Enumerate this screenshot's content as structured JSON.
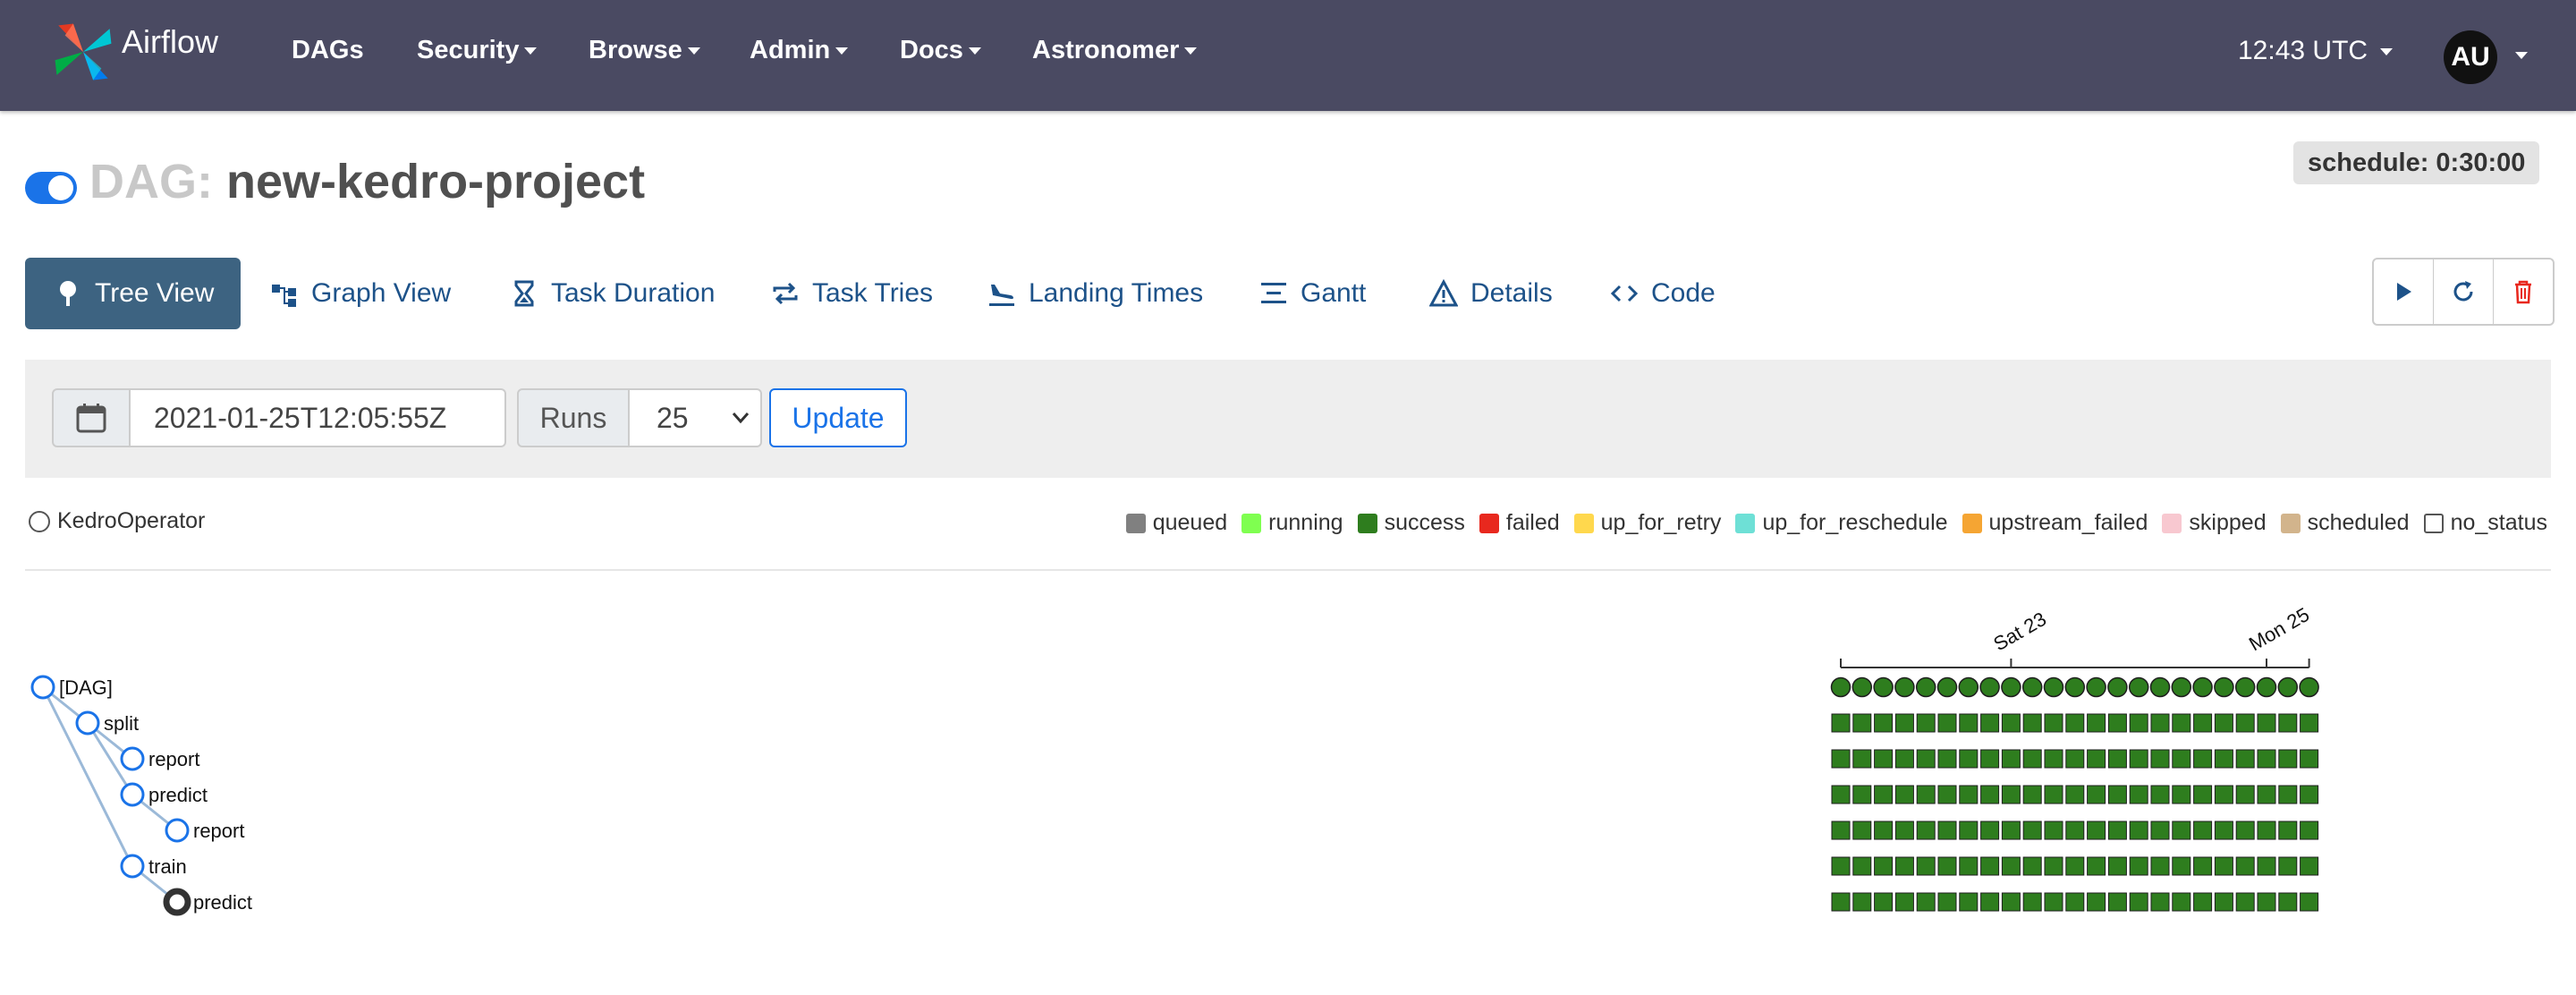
{
  "nav": {
    "brand": "Airflow",
    "items": [
      "DAGs",
      "Security",
      "Browse",
      "Admin",
      "Docs",
      "Astronomer"
    ],
    "time": "12:43 UTC",
    "avatar": "AU"
  },
  "dag": {
    "prefix": "DAG:",
    "name": "new-kedro-project",
    "schedule": "schedule: 0:30:00",
    "paused": false
  },
  "tabs": [
    {
      "label": "Tree View",
      "icon": "tree-icon",
      "active": true
    },
    {
      "label": "Graph View",
      "icon": "graph-icon"
    },
    {
      "label": "Task Duration",
      "icon": "hourglass-icon"
    },
    {
      "label": "Task Tries",
      "icon": "repeat-icon"
    },
    {
      "label": "Landing Times",
      "icon": "plane-landing-icon"
    },
    {
      "label": "Gantt",
      "icon": "gantt-icon"
    },
    {
      "label": "Details",
      "icon": "warning-triangle-icon"
    },
    {
      "label": "Code",
      "icon": "code-icon"
    }
  ],
  "filters": {
    "date": "2021-01-25T12:05:55Z",
    "runs_label": "Runs",
    "runs_value": "25",
    "update_label": "Update"
  },
  "operator_legend": "KedroOperator",
  "states": [
    {
      "label": "queued",
      "color": "#808080"
    },
    {
      "label": "running",
      "color": "#7fff50"
    },
    {
      "label": "success",
      "color": "#2e7d1e"
    },
    {
      "label": "failed",
      "color": "#e8281e"
    },
    {
      "label": "up_for_retry",
      "color": "#ffd84d"
    },
    {
      "label": "up_for_reschedule",
      "color": "#6ee0d6"
    },
    {
      "label": "upstream_failed",
      "color": "#f5a533"
    },
    {
      "label": "skipped",
      "color": "#f8c8d0"
    },
    {
      "label": "scheduled",
      "color": "#d2b48c"
    },
    {
      "label": "no_status",
      "color": "#ffffff"
    }
  ],
  "tree": {
    "nodes": [
      {
        "label": "[DAG]",
        "depth": 0
      },
      {
        "label": "split",
        "depth": 1
      },
      {
        "label": "report",
        "depth": 2
      },
      {
        "label": "predict",
        "depth": 2
      },
      {
        "label": "report",
        "depth": 3
      },
      {
        "label": "train",
        "depth": 2
      },
      {
        "label": "predict",
        "depth": 3
      }
    ],
    "dates": [
      "Sat 23",
      "Mon 25"
    ],
    "run_count": 23,
    "run_state": "success"
  }
}
